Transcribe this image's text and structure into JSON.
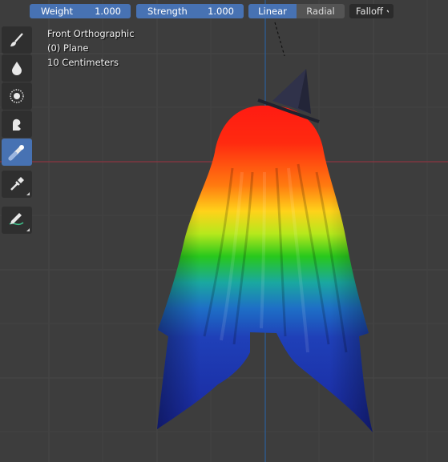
{
  "header": {
    "weight": {
      "label": "Weight",
      "value": "1.000"
    },
    "strength": {
      "label": "Strength",
      "value": "1.000"
    },
    "falloff_shape": {
      "options": [
        "Linear",
        "Radial"
      ],
      "selected": "Linear"
    },
    "falloff_menu": {
      "label": "Falloff"
    }
  },
  "overlay": {
    "view_name": "Front Orthographic",
    "object": "(0) Plane",
    "scale": "10 Centimeters"
  },
  "tools": [
    {
      "name": "draw-tool",
      "icon": "brush-icon"
    },
    {
      "name": "blur-tool",
      "icon": "drop-icon"
    },
    {
      "name": "average-tool",
      "icon": "sun-icon"
    },
    {
      "name": "smear-tool",
      "icon": "finger-icon"
    },
    {
      "name": "gradient-tool",
      "icon": "gradient-icon",
      "active": true
    },
    {
      "name": "sample-weight-tool",
      "icon": "eyedropper-icon"
    },
    {
      "name": "annotate-tool",
      "icon": "pencil-icon"
    }
  ],
  "colors": {
    "accent": "#4772b3",
    "background": "#3d3d3d",
    "grid": "#474747",
    "x_axis": "#8a3541",
    "z_axis": "#2c5d94"
  }
}
